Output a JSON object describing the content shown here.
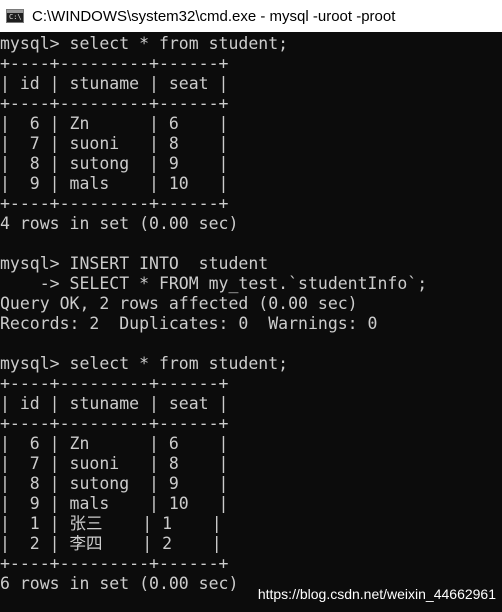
{
  "window": {
    "title": "C:\\WINDOWS\\system32\\cmd.exe - mysql  -uroot -proot"
  },
  "icons": {
    "app": "cmd-icon"
  },
  "colors": {
    "console_background": "#0c0c0c",
    "console_text": "#cccccc",
    "titlebar_background": "#ffffff"
  },
  "console": {
    "lines": [
      "mysql> select * from student;",
      "+----+---------+------+",
      "| id | stuname | seat |",
      "+----+---------+------+",
      "|  6 | Zn      | 6    |",
      "|  7 | suoni   | 8    |",
      "|  8 | sutong  | 9    |",
      "|  9 | mals    | 10   |",
      "+----+---------+------+",
      "4 rows in set (0.00 sec)",
      "",
      "mysql> INSERT INTO  student",
      "    -> SELECT * FROM my_test.`studentInfo`;",
      "Query OK, 2 rows affected (0.00 sec)",
      "Records: 2  Duplicates: 0  Warnings: 0",
      "",
      "mysql> select * from student;",
      "+----+---------+------+",
      "| id | stuname | seat |",
      "+----+---------+------+",
      "|  6 | Zn      | 6    |",
      "|  7 | suoni   | 8    |",
      "|  8 | sutong  | 9    |",
      "|  9 | mals    | 10   |",
      "|  1 | 张三    | 1    |",
      "|  2 | 李四    | 2    |",
      "+----+---------+------+",
      "6 rows in set (0.00 sec)"
    ]
  },
  "watermark": "https://blog.csdn.net/weixin_44662961"
}
